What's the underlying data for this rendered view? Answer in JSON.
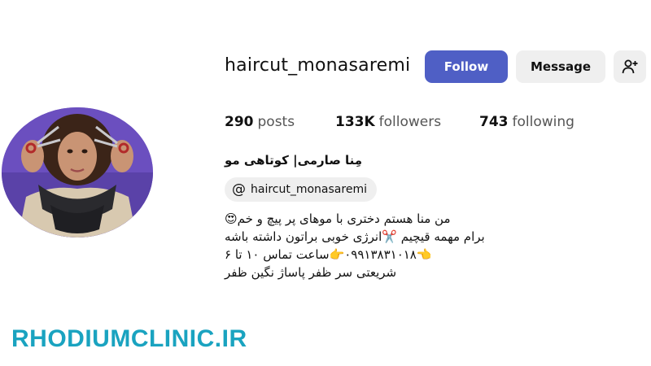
{
  "profile": {
    "username": "haircut_monasaremi",
    "full_name": "مِنا صارمی| کوتاهی مو",
    "threads_handle": "haircut_monasaremi"
  },
  "actions": {
    "follow_label": "Follow",
    "message_label": "Message",
    "suggest_icon": "add-person-icon"
  },
  "stats": {
    "posts_count": "290",
    "posts_label": "posts",
    "followers_count": "133K",
    "followers_label": "followers",
    "following_count": "743",
    "following_label": "following"
  },
  "bio": {
    "line1": "من منا هستم دختری با موهای پر پیچ و خم😍",
    "line2": "برام مهمه قیچیم ✂️انرژی خوبی براتون داشته باشه",
    "line3": "👈۰۹۹۱۳۸۳۱۰۱۸👉ساعت تماس ۱۰ تا ۶",
    "line4": "شریعتی سر ظفر پاساژ نگین ظفر"
  },
  "watermark": {
    "text": "RHODIUMCLINIC.IR",
    "color": "#1aa3c0"
  },
  "colors": {
    "follow_button": "#4f5fc5",
    "secondary_button": "#efefef",
    "avatar_background": "#6b4fbf"
  }
}
